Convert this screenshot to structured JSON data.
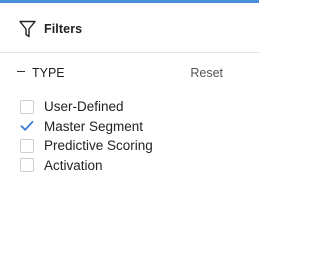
{
  "colors": {
    "accent": "#4a90d9",
    "check": "#3a7bd5",
    "divider": "#e6e6e6"
  },
  "panel": {
    "icon": "funnel-icon",
    "title": "Filters"
  },
  "section": {
    "toggle_symbol": "–",
    "title": "TYPE",
    "reset_label": "Reset"
  },
  "options": [
    {
      "label": "User-Defined",
      "checked": false
    },
    {
      "label": "Master Segment",
      "checked": true
    },
    {
      "label": "Predictive Scoring",
      "checked": false
    },
    {
      "label": "Activation",
      "checked": false
    }
  ]
}
